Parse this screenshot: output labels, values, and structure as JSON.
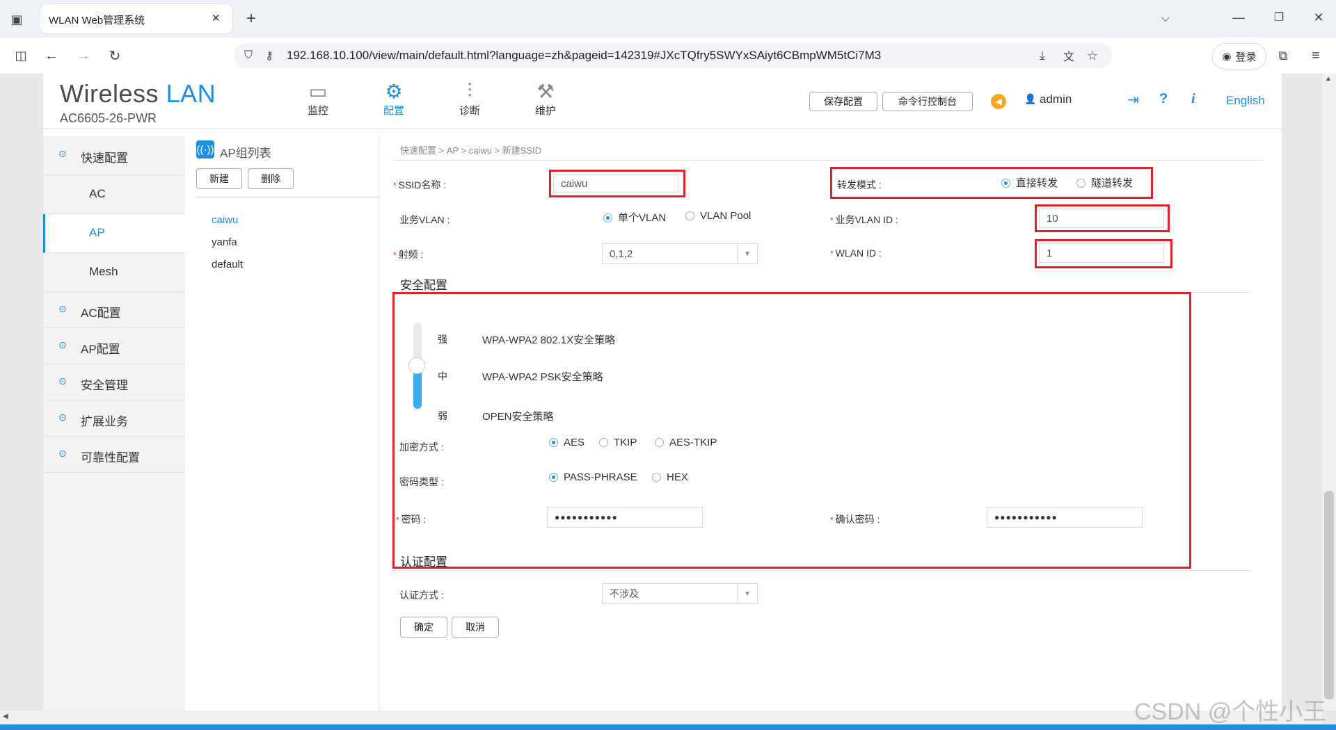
{
  "browser": {
    "tab_title": "WLAN Web管理系统",
    "tab_close": "✕",
    "new_tab": "+",
    "url": "192.168.10.100/view/main/default.html?language=zh&pageid=142319#JXcTQfry5SWYxSAiyt6CBmpWM5tCi7M3",
    "login_label": "登录"
  },
  "brand": {
    "name": "Wireless LAN",
    "model": "AC6605-26-PWR"
  },
  "nav": [
    {
      "label": "监控",
      "icon": "monitor-icon"
    },
    {
      "label": "配置",
      "icon": "gear-icon"
    },
    {
      "label": "诊断",
      "icon": "sliders-icon"
    },
    {
      "label": "维护",
      "icon": "maintenance-icon"
    }
  ],
  "header": {
    "save": "保存配置",
    "console": "命令行控制台",
    "user": "admin",
    "lang": "English"
  },
  "sidebar": {
    "items": [
      {
        "label": "快速配置",
        "expanded": true
      },
      {
        "label": "AC"
      },
      {
        "label": "AP",
        "selected": true
      },
      {
        "label": "Mesh"
      },
      {
        "label": "AC配置"
      },
      {
        "label": "AP配置"
      },
      {
        "label": "安全管理"
      },
      {
        "label": "扩展业务"
      },
      {
        "label": "可靠性配置"
      }
    ]
  },
  "aplist": {
    "title": "AP组列表",
    "new_btn": "新建",
    "delete_btn": "删除",
    "groups": [
      "caiwu",
      "yanfa",
      "default"
    ]
  },
  "form": {
    "breadcrumb": "快速配置 > AP > caiwu > 新建SSID",
    "ssid_label": "SSID名称 :",
    "ssid_value": "caiwu",
    "forward_label": "转发模式 :",
    "forward_opts": [
      "直接转发",
      "隧道转发"
    ],
    "vlan_label": "业务VLAN :",
    "vlan_opts": [
      "单个VLAN",
      "VLAN Pool"
    ],
    "vlanid_label": "业务VLAN ID :",
    "vlanid_value": "10",
    "radio_label": "射频 :",
    "radio_value": "0,1,2",
    "wlanid_label": "WLAN ID :",
    "wlanid_value": "1",
    "security_title": "安全配置",
    "levels": [
      {
        "level": "强",
        "policy": "WPA-WPA2 802.1X安全策略"
      },
      {
        "level": "中",
        "policy": "WPA-WPA2 PSK安全策略"
      },
      {
        "level": "弱",
        "policy": "OPEN安全策略"
      }
    ],
    "security_level_fraction": 0.5,
    "encrypt_label": "加密方式 :",
    "encrypt_opts": [
      "AES",
      "TKIP",
      "AES-TKIP"
    ],
    "pwtype_label": "密码类型 :",
    "pwtype_opts": [
      "PASS-PHRASE",
      "HEX"
    ],
    "pw_label": "密码 :",
    "pw_value": "●●●●●●●●●●●",
    "pw_confirm_label": "确认密码 :",
    "pw_confirm_value": "●●●●●●●●●●●",
    "auth_title": "认证配置",
    "auth_label": "认证方式 :",
    "auth_value": "不涉及",
    "ok_btn": "确定",
    "cancel_btn": "取消"
  },
  "watermark": "CSDN @个性小王",
  "colors": {
    "accent": "#1e8fe0",
    "highlight": "#e3202a",
    "brand_blue": "#1e8fe0"
  }
}
